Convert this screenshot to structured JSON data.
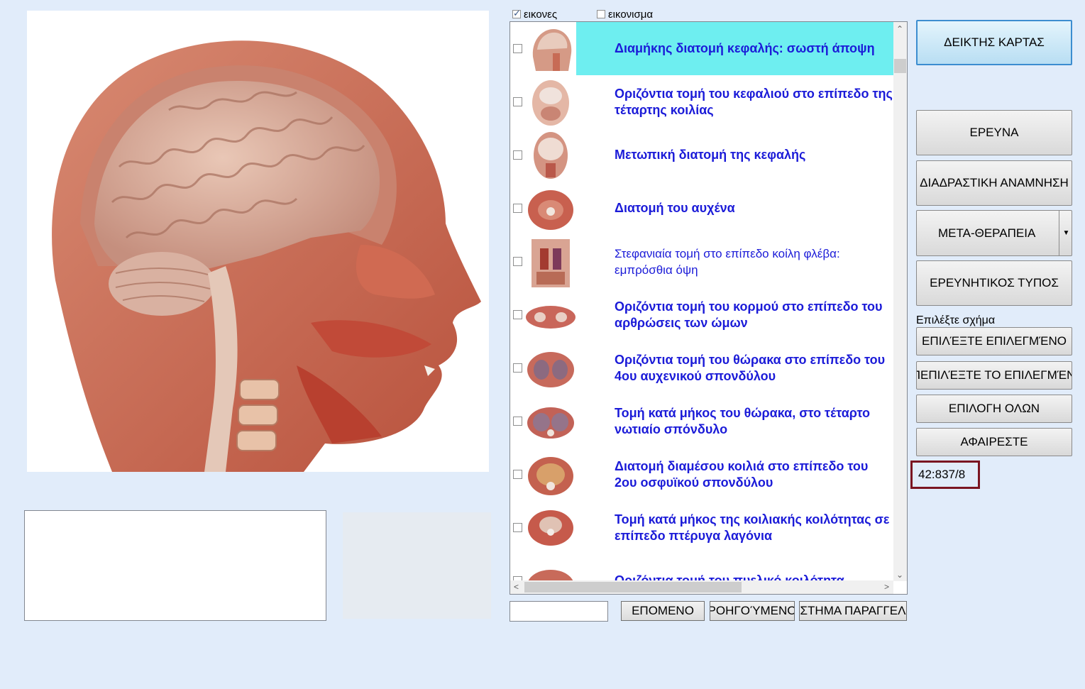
{
  "checks": {
    "images_label": "εικονες",
    "images_checked": true,
    "icons_label": "εικονισμα",
    "icons_checked": false
  },
  "list": {
    "items": [
      {
        "title": "Διαμήκης διατομή κεφαλής: σωστή άποψη",
        "selected": true,
        "bold": true
      },
      {
        "title": "Οριζόντια τομή του κεφαλιού στο επίπεδο της τέταρτης κοιλίας",
        "bold": true
      },
      {
        "title": "Μετωπική διατομή της κεφαλής",
        "bold": true
      },
      {
        "title": "Διατομή του αυχένα",
        "bold": true
      },
      {
        "title": "Στεφανιαία τομή στο επίπεδο κοίλη φλέβα: εμπρόσθια όψη",
        "bold": false
      },
      {
        "title": "Οριζόντια τομή του κορμού στο επίπεδο του αρθρώσεις των ώμων",
        "bold": true
      },
      {
        "title": "Οριζόντια τομή του θώρακα στο επίπεδο του 4ου αυχενικού σπονδύλου",
        "bold": true
      },
      {
        "title": "Τομή κατά μήκος του θώρακα, στο τέταρτο νωτιαίο σπόνδυλο",
        "bold": true
      },
      {
        "title": "Διατομή διαμέσου κοιλιά στο επίπεδο του 2ου οσφυϊκού σπονδύλου",
        "bold": true
      },
      {
        "title": "Τομή κατά μήκος της κοιλιακής κοιλότητας σε επίπεδο πτέρυγα λαγόνια",
        "bold": true
      },
      {
        "title": "Οριζόντια τομή του πυελικό κοιλότητα",
        "bold": true
      }
    ]
  },
  "nav": {
    "next": "ΕΠΟΜΕΝΟ",
    "previous": "ΡΟΗΓΟΎΜΕΝΟ",
    "order": "ΣΤΗΜΑ ΠΑΡΑΓΓΕΛ"
  },
  "buttons": {
    "card_index": "ΔΕΙΚΤΗΣ ΚΑΡΤΑΣ",
    "research": "ΕΡΕΥΝΑ",
    "interactive_anamnesis": "ΔΙΑΔΡΑΣΤΙΚΗ ΑΝΑΜΝΗΣΗ",
    "meta_therapy": "ΜΕΤΑ-ΘΕΡΑΠΕΙΑ",
    "research_type": "ΕΡΕΥΝΗΤΙΚΟΣ ΤΥΠΟΣ",
    "select_shape_label": "Επιλέξτε σχήμα",
    "select_selected": "ΕΠΙΛΈΞΤΕ ΕΠΙΛΕΓΜΈΝΟ",
    "deselect_selected": "ΑΠΕΠΙΛΈΞΤΕ ΤΟ ΕΠΙΛΕΓΜΈΝΟ",
    "select_all": "ΕΠΙΛΟΓΗ ΟΛΩΝ",
    "remove": "ΑΦΑΙΡΕΣΤΕ"
  },
  "counter": "42:837/8"
}
